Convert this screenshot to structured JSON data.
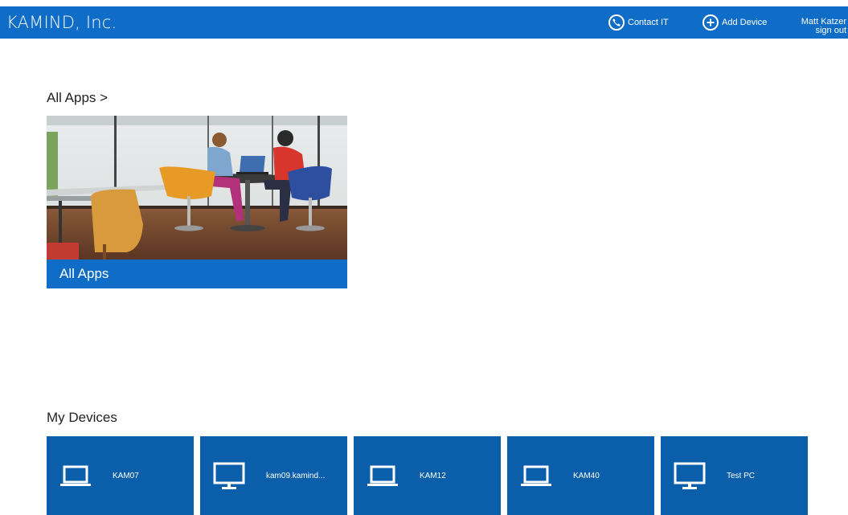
{
  "header": {
    "brand": "KAMIND, Inc.",
    "contact_label": "Contact IT",
    "contact_icon": "phone-icon",
    "add_device_label": "Add Device",
    "add_device_icon": "plus-circle-icon",
    "user_name": "Matt Katzer",
    "sign_out_label": "sign out",
    "background_color": "#0f6dc7"
  },
  "apps_section": {
    "heading": "All Apps >",
    "tile_label": "All Apps",
    "tile_image": "people-at-table-with-laptop-photo"
  },
  "devices_section": {
    "heading": "My Devices",
    "tile_color": "#0b5ea9",
    "devices": [
      {
        "name": "KAM07",
        "icon": "laptop-icon"
      },
      {
        "name": "kam09.kamind...",
        "icon": "desktop-monitor-icon"
      },
      {
        "name": "KAM12",
        "icon": "laptop-icon"
      },
      {
        "name": "KAM40",
        "icon": "laptop-icon"
      },
      {
        "name": "Test PC",
        "icon": "desktop-monitor-icon"
      }
    ]
  }
}
